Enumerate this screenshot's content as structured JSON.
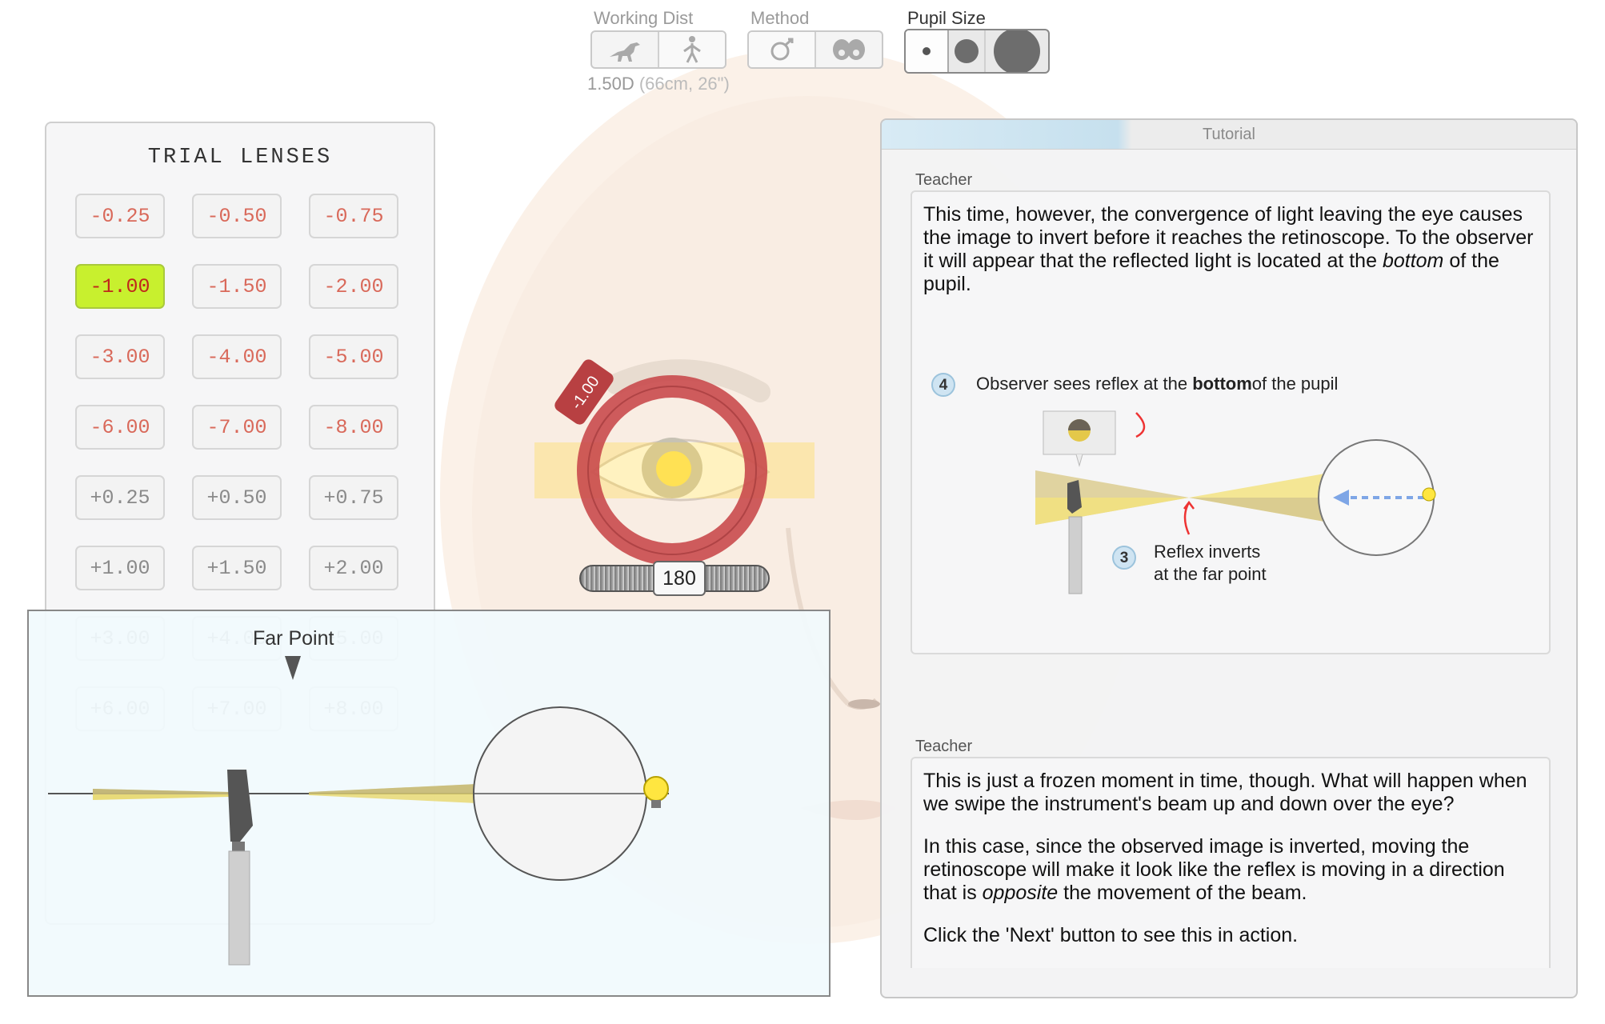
{
  "toolbar": {
    "working_dist": {
      "label": "Working Dist",
      "value": "1.50D",
      "detail": "(66cm, 26\")",
      "options": [
        {
          "icon": "dinosaur-icon"
        },
        {
          "icon": "standing-person-icon"
        }
      ]
    },
    "method": {
      "label": "Method",
      "options": [
        {
          "icon": "retinoscope-icon"
        },
        {
          "icon": "double-eye-icon"
        }
      ]
    },
    "pupil_size": {
      "label": "Pupil Size",
      "options": [
        {
          "icon": "small-pupil-icon"
        },
        {
          "icon": "medium-pupil-icon"
        },
        {
          "icon": "large-pupil-icon"
        }
      ]
    }
  },
  "trial_lenses": {
    "title": "TRIAL LENSES",
    "selected": "-1.00",
    "lenses": [
      "-0.25",
      "-0.50",
      "-0.75",
      "-1.00",
      "-1.50",
      "-2.00",
      "-3.00",
      "-4.00",
      "-5.00",
      "-6.00",
      "-7.00",
      "-8.00",
      "+0.25",
      "+0.50",
      "+0.75",
      "+1.00",
      "+1.50",
      "+2.00",
      "+3.00",
      "+4.00",
      "+5.00",
      "+6.00",
      "+7.00",
      "+8.00"
    ]
  },
  "eye_view": {
    "lens_tag": "-1.00",
    "axis_value": "180"
  },
  "diagram": {
    "far_point_label": "Far Point"
  },
  "tutorial": {
    "header": "Tutorial",
    "messages": [
      {
        "speaker": "Teacher",
        "text": "This time, however, the convergence of light leaving the eye causes the image to invert before it reaches the retinoscope. To the observer it will appear that the reflected light is located at the ",
        "emph": "bottom",
        "text_end": " of the pupil.",
        "steps": [
          {
            "num": "4",
            "text": "Observer sees reflex at the ",
            "bold": "bottom",
            "text_end": "of the pupil"
          },
          {
            "num": "3",
            "line1": "Reflex inverts",
            "line2": "at the far point"
          }
        ]
      },
      {
        "speaker": "Teacher",
        "p1": "This is just a frozen moment in time, though. What will happen when we swipe the instrument's beam up and down over the eye?",
        "p2_start": "In this case, since the observed image is inverted, moving the retinoscope will make it look like the reflex is moving in a direction that is ",
        "p2_emph": "opposite",
        "p2_end": " the movement of the beam.",
        "p3": "Click the 'Next' button to see this in action."
      }
    ]
  }
}
